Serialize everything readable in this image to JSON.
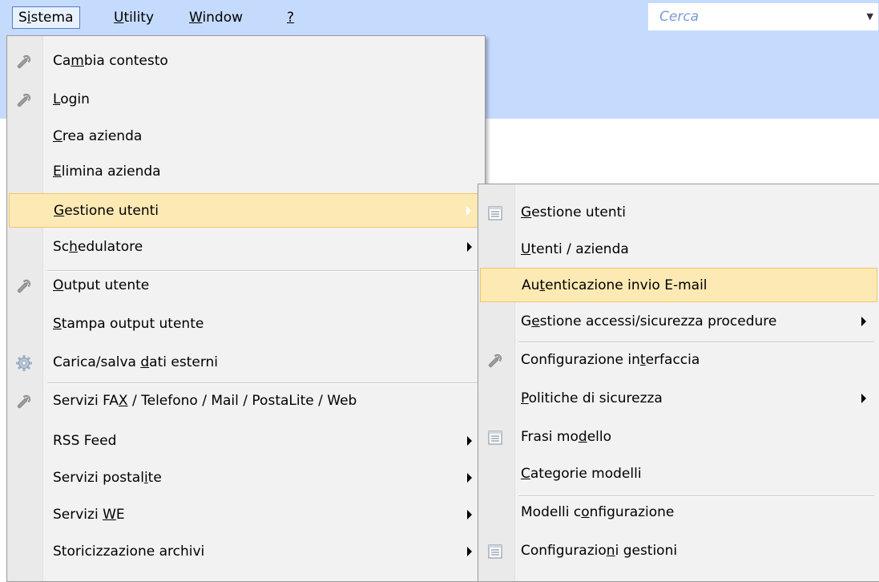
{
  "menubar": {
    "items": [
      {
        "label": "Sistema",
        "mnemonic_index": 1
      },
      {
        "label": "Utility",
        "mnemonic_index": 0
      },
      {
        "label": "Window",
        "mnemonic_index": 0
      },
      {
        "label": "?",
        "mnemonic_index": 0
      }
    ],
    "search_placeholder": "Cerca"
  },
  "sistema_menu": [
    {
      "label": "Cambia contesto",
      "u": 2,
      "icon": "wrench-icon"
    },
    {
      "label": "Login",
      "u": 0,
      "icon": "wrench-icon"
    },
    {
      "label": "Crea azienda",
      "u": 0
    },
    {
      "label": "Elimina azienda",
      "u": 0
    },
    {
      "label": "Gestione utenti",
      "u": 0,
      "submenu": true,
      "highlighted": true
    },
    {
      "label": "Schedulatore",
      "u": 2,
      "submenu": true
    },
    {
      "label": "Output utente",
      "u": 0,
      "icon": "wrench-icon"
    },
    {
      "label": "Stampa output utente",
      "u": 0
    },
    {
      "label": "Carica/salva dati esterni",
      "u": 13,
      "icon": "gear-icon"
    },
    {
      "label": "Servizi FAX / Telefono / Mail / PostaLite / Web",
      "u": 10,
      "icon": "wrench-icon"
    },
    {
      "label": "RSS Feed",
      "u": -1,
      "submenu": true
    },
    {
      "label": "Servizi postalite",
      "u": 14,
      "submenu": true
    },
    {
      "label": "Servizi WE",
      "u": 8,
      "submenu": true
    },
    {
      "label": "Storicizzazione archivi",
      "u": -1,
      "submenu": true
    }
  ],
  "gestione_utenti_menu": [
    {
      "label": "Gestione utenti",
      "u": 0,
      "icon": "list-icon"
    },
    {
      "label": "Utenti / azienda",
      "u": 0
    },
    {
      "label": "Autenticazione invio E-mail",
      "u": 2,
      "highlighted": true
    },
    {
      "label": "Gestione accessi/sicurezza procedure",
      "u": 1,
      "submenu": true
    },
    {
      "label": "Configurazione interfaccia",
      "u": 17,
      "icon": "wrench-icon"
    },
    {
      "label": "Politiche di sicurezza",
      "u": 0,
      "submenu": true
    },
    {
      "label": "Frasi modello",
      "u": 8,
      "icon": "list-icon"
    },
    {
      "label": "Categorie modelli",
      "u": 0
    },
    {
      "label": "Modelli configurazione",
      "u": 9
    },
    {
      "label": "Configurazioni gestioni",
      "u": 12,
      "icon": "list-icon"
    }
  ]
}
